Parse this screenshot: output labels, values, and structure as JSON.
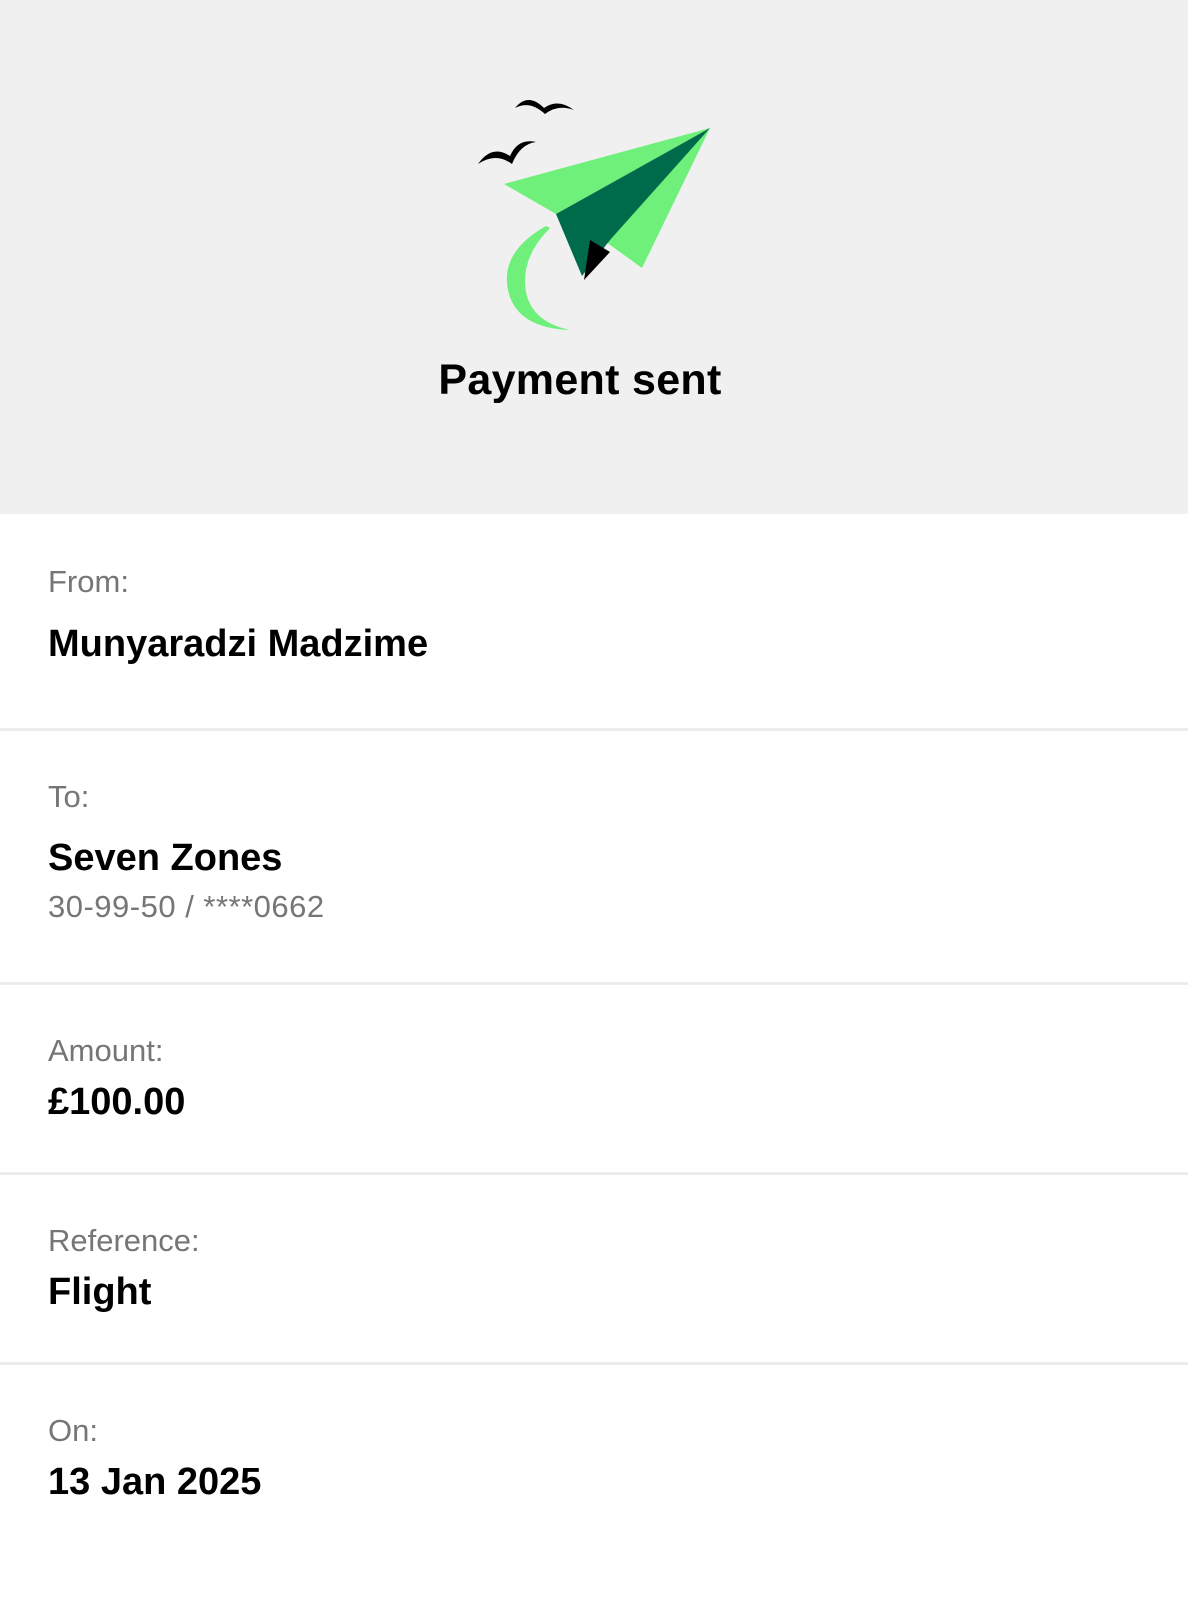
{
  "header": {
    "title": "Payment sent",
    "icon": "paper-plane-birds-icon"
  },
  "details": {
    "from": {
      "label": "From:",
      "value": "Munyaradzi Madzime"
    },
    "to": {
      "label": "To:",
      "value": "Seven Zones",
      "account": "30-99-50 / ****0662"
    },
    "amount": {
      "label": "Amount:",
      "value": "£100.00"
    },
    "reference": {
      "label": "Reference:",
      "value": "Flight"
    },
    "on": {
      "label": "On:",
      "value": "13 Jan 2025"
    }
  },
  "colors": {
    "header_bg": "#f0f0f0",
    "accent_light_green": "#6ef07a",
    "accent_dark_green": "#006b4a",
    "label_gray": "#767676",
    "divider": "#ececec"
  }
}
